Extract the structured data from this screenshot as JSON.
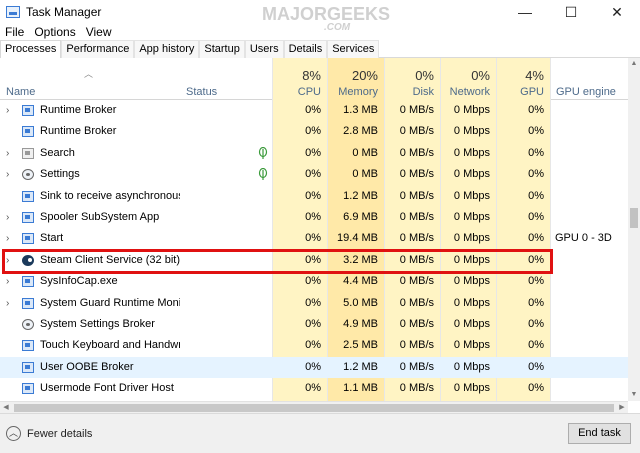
{
  "window": {
    "title": "Task Manager",
    "watermark_line1": "MAJORGEEKS",
    "watermark_line2": ".COM",
    "controls": {
      "minimize": "—",
      "maximize": "☐",
      "close": "✕"
    }
  },
  "menu": [
    {
      "label": "File"
    },
    {
      "label": "Options"
    },
    {
      "label": "View"
    }
  ],
  "tabs": [
    {
      "label": "Processes",
      "active": true
    },
    {
      "label": "Performance"
    },
    {
      "label": "App history"
    },
    {
      "label": "Startup"
    },
    {
      "label": "Users"
    },
    {
      "label": "Details"
    },
    {
      "label": "Services"
    }
  ],
  "columns": {
    "name": "Name",
    "status": "Status",
    "cpu": {
      "pct": "8%",
      "label": "CPU"
    },
    "memory": {
      "pct": "20%",
      "label": "Memory"
    },
    "disk": {
      "pct": "0%",
      "label": "Disk"
    },
    "network": {
      "pct": "0%",
      "label": "Network"
    },
    "gpu": {
      "pct": "4%",
      "label": "GPU"
    },
    "gpu_engine": "GPU engine"
  },
  "rows": [
    {
      "name": "Runtime Broker",
      "expand": true,
      "icon": "app-icon",
      "cpu": "0%",
      "mem": "1.3 MB",
      "disk": "0 MB/s",
      "net": "0 Mbps",
      "gpu": "0%",
      "engine": ""
    },
    {
      "name": "Runtime Broker",
      "expand": false,
      "icon": "app-icon",
      "cpu": "0%",
      "mem": "2.8 MB",
      "disk": "0 MB/s",
      "net": "0 Mbps",
      "gpu": "0%",
      "engine": ""
    },
    {
      "name": "Search",
      "expand": true,
      "icon": "search-icon",
      "leaf": true,
      "cpu": "0%",
      "mem": "0 MB",
      "disk": "0 MB/s",
      "net": "0 Mbps",
      "gpu": "0%",
      "engine": ""
    },
    {
      "name": "Settings",
      "expand": true,
      "icon": "gear-icon",
      "leaf": true,
      "cpu": "0%",
      "mem": "0 MB",
      "disk": "0 MB/s",
      "net": "0 Mbps",
      "gpu": "0%",
      "engine": ""
    },
    {
      "name": "Sink to receive asynchronous ca...",
      "expand": false,
      "icon": "app-icon",
      "cpu": "0%",
      "mem": "1.2 MB",
      "disk": "0 MB/s",
      "net": "0 Mbps",
      "gpu": "0%",
      "engine": ""
    },
    {
      "name": "Spooler SubSystem App",
      "expand": true,
      "icon": "printer-icon",
      "cpu": "0%",
      "mem": "6.9 MB",
      "disk": "0 MB/s",
      "net": "0 Mbps",
      "gpu": "0%",
      "engine": ""
    },
    {
      "name": "Start",
      "expand": true,
      "icon": "app-icon",
      "cpu": "0%",
      "mem": "19.4 MB",
      "disk": "0 MB/s",
      "net": "0 Mbps",
      "gpu": "0%",
      "engine": "GPU 0 - 3D"
    },
    {
      "name": "Steam Client Service (32 bit)",
      "expand": true,
      "icon": "steam-icon",
      "cpu": "0%",
      "mem": "3.2 MB",
      "disk": "0 MB/s",
      "net": "0 Mbps",
      "gpu": "0%",
      "engine": ""
    },
    {
      "name": "SysInfoCap.exe",
      "expand": true,
      "icon": "app-icon",
      "cpu": "0%",
      "mem": "4.4 MB",
      "disk": "0 MB/s",
      "net": "0 Mbps",
      "gpu": "0%",
      "engine": ""
    },
    {
      "name": "System Guard Runtime Monitor...",
      "expand": true,
      "icon": "app-icon",
      "cpu": "0%",
      "mem": "5.0 MB",
      "disk": "0 MB/s",
      "net": "0 Mbps",
      "gpu": "0%",
      "engine": ""
    },
    {
      "name": "System Settings Broker",
      "expand": false,
      "icon": "gear-icon",
      "cpu": "0%",
      "mem": "4.9 MB",
      "disk": "0 MB/s",
      "net": "0 Mbps",
      "gpu": "0%",
      "engine": ""
    },
    {
      "name": "Touch Keyboard and Handwriti...",
      "expand": false,
      "icon": "app-icon",
      "cpu": "0%",
      "mem": "2.5 MB",
      "disk": "0 MB/s",
      "net": "0 Mbps",
      "gpu": "0%",
      "engine": ""
    },
    {
      "name": "User OOBE Broker",
      "expand": false,
      "icon": "app-icon",
      "selected": true,
      "cpu": "0%",
      "mem": "1.2 MB",
      "disk": "0 MB/s",
      "net": "0 Mbps",
      "gpu": "0%",
      "engine": ""
    },
    {
      "name": "Usermode Font Driver Host",
      "expand": false,
      "icon": "app-icon",
      "cpu": "0%",
      "mem": "1.1 MB",
      "disk": "0 MB/s",
      "net": "0 Mbps",
      "gpu": "0%",
      "engine": ""
    }
  ],
  "highlight_color": "#e01111",
  "footer": {
    "fewer_details": "Fewer details",
    "end_task": "End task"
  }
}
